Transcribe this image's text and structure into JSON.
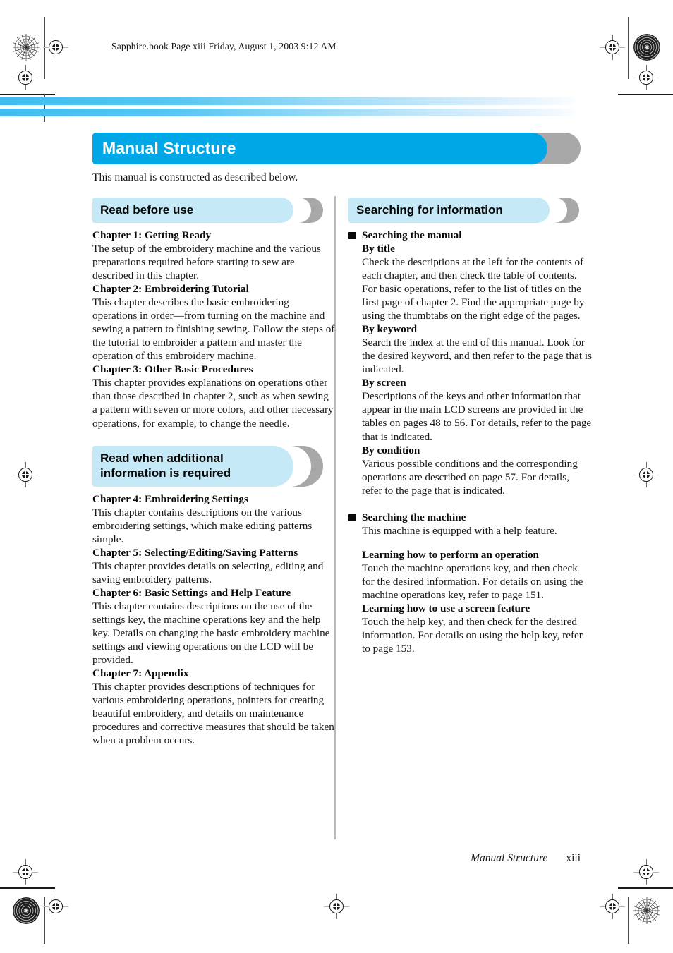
{
  "running_header": "Sapphire.book  Page xiii  Friday, August 1, 2003  9:12 AM",
  "title": "Manual Structure",
  "intro": "This manual is constructed as described below.",
  "colors": {
    "title_bar": "#00a7e7",
    "section_bar": "#c5e9f7",
    "shadow": "#a8a8a8",
    "stripe": "#3fbdf0"
  },
  "left_column": {
    "sections": [
      {
        "heading": "Read before use",
        "entries": [
          {
            "title": "Chapter 1: Getting Ready",
            "body": "The setup of the embroidery machine and the various preparations required before starting to sew are described in this chapter."
          },
          {
            "title": "Chapter 2: Embroidering Tutorial",
            "body": "This chapter describes the basic embroidering operations in order—from turning on the machine and sewing a pattern to finishing sewing. Follow the steps of the tutorial to embroider a pattern and master the operation of this embroidery machine."
          },
          {
            "title": "Chapter 3: Other Basic Procedures",
            "body": "This chapter provides explanations on operations other than those described in chapter 2, such as when sewing a pattern with seven or more colors, and other necessary operations, for example, to change the needle."
          }
        ]
      },
      {
        "heading_line1": "Read when additional",
        "heading_line2": "information is required",
        "entries": [
          {
            "title": "Chapter 4: Embroidering Settings",
            "body": "This chapter contains descriptions on the various embroidering settings, which make editing patterns simple."
          },
          {
            "title": "Chapter 5: Selecting/Editing/Saving Patterns",
            "body": "This chapter provides details on selecting, editing and saving embroidery patterns."
          },
          {
            "title": "Chapter 6: Basic Settings and Help Feature",
            "body": "This chapter contains descriptions on the use of the settings key, the machine operations key and the help key. Details on changing the basic embroidery machine settings and viewing operations on the LCD will be provided."
          },
          {
            "title": "Chapter 7: Appendix",
            "body": "This chapter provides descriptions of techniques for various embroidering operations, pointers for creating beautiful embroidery, and details on maintenance procedures and corrective measures that should be taken when a problem occurs."
          }
        ]
      }
    ]
  },
  "right_column": {
    "section_heading": "Searching for information",
    "groups": [
      {
        "bullet_title": "Searching the manual",
        "items": [
          {
            "title": "By title",
            "body1": "Check the descriptions at the left for the contents of each chapter, and then check the table of contents.",
            "body2": "For basic operations, refer to the list of titles on the first page of chapter 2. Find the appropriate page by using the thumbtabs on the right edge of the pages."
          },
          {
            "title": "By keyword",
            "body1": "Search the index at the end of this manual. Look for the desired keyword, and then refer to the page that is indicated."
          },
          {
            "title": "By screen",
            "body1": "Descriptions of the keys and other information that appear in the main LCD screens are provided in the tables on pages 48 to 56. For details, refer to the page that is indicated."
          },
          {
            "title": "By condition",
            "body1": "Various possible conditions and the corresponding operations are described on page 57. For details, refer to the page that is indicated."
          }
        ]
      },
      {
        "bullet_title": "Searching the machine",
        "lead": "This machine is equipped with a help feature.",
        "items": [
          {
            "title": "Learning how to perform an operation",
            "body1": "Touch the machine operations key, and then check for the desired information. For details on using the machine operations key, refer to page 151."
          },
          {
            "title": "Learning how to use a screen feature",
            "body1": "Touch the help key, and then check for the desired information. For details on using the help key, refer to page 153."
          }
        ]
      }
    ]
  },
  "footer": {
    "name": "Manual Structure",
    "page": "xiii"
  }
}
